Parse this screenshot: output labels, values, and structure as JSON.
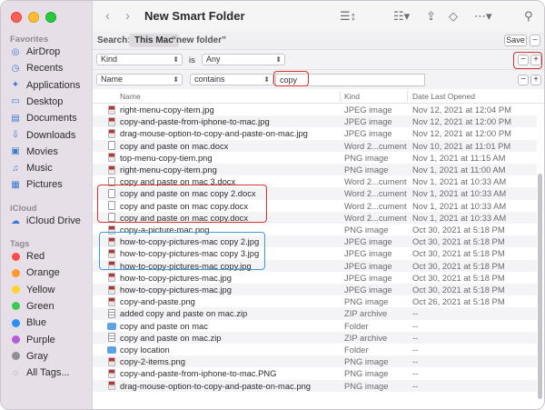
{
  "window": {
    "title": "New Smart Folder"
  },
  "sidebar": {
    "favorites_label": "Favorites",
    "favorites": [
      {
        "label": "AirDrop",
        "icon": "airdrop-icon"
      },
      {
        "label": "Recents",
        "icon": "clock-icon"
      },
      {
        "label": "Applications",
        "icon": "applications-icon"
      },
      {
        "label": "Desktop",
        "icon": "desktop-icon"
      },
      {
        "label": "Documents",
        "icon": "document-icon"
      },
      {
        "label": "Downloads",
        "icon": "download-icon"
      },
      {
        "label": "Movies",
        "icon": "film-icon"
      },
      {
        "label": "Music",
        "icon": "music-note-icon"
      },
      {
        "label": "Pictures",
        "icon": "photo-icon"
      }
    ],
    "icloud_label": "iCloud",
    "icloud": [
      {
        "label": "iCloud Drive",
        "icon": "cloud-icon"
      }
    ],
    "tags_label": "Tags",
    "tags": [
      {
        "label": "Red",
        "color": "#fe4a49"
      },
      {
        "label": "Orange",
        "color": "#fd9a2b"
      },
      {
        "label": "Yellow",
        "color": "#fdd32f"
      },
      {
        "label": "Green",
        "color": "#3fc952"
      },
      {
        "label": "Blue",
        "color": "#2d8ff5"
      },
      {
        "label": "Purple",
        "color": "#b65cd9"
      },
      {
        "label": "Gray",
        "color": "#8e8e93"
      },
      {
        "label": "All Tags...",
        "color": ""
      }
    ]
  },
  "search": {
    "label": "Search:",
    "scope": "This Mac",
    "query": "“new folder”",
    "save_label": "Save"
  },
  "criteria": [
    {
      "attribute": "Kind",
      "operator": "is",
      "value": "Any"
    },
    {
      "attribute": "Name",
      "operator": "contains",
      "value": "copy"
    }
  ],
  "columns": {
    "name": "Name",
    "kind": "Kind",
    "date": "Date Last Opened"
  },
  "files": [
    {
      "name": "right-menu-copy-item.jpg",
      "kind": "JPEG image",
      "date": "Nov 12, 2021 at 12:04 PM",
      "type": "img"
    },
    {
      "name": "copy-and-paste-from-iphone-to-mac.jpg",
      "kind": "JPEG image",
      "date": "Nov 12, 2021 at 12:00 PM",
      "type": "img"
    },
    {
      "name": "drag-mouse-option-to-copy-and-paste-on-mac.jpg",
      "kind": "JPEG image",
      "date": "Nov 12, 2021 at 12:00 PM",
      "type": "img"
    },
    {
      "name": "copy and paste on mac.docx",
      "kind": "Word 2...cument",
      "date": "Nov 10, 2021 at 11:01 PM",
      "type": "word"
    },
    {
      "name": "top-menu-copy-tiem.png",
      "kind": "PNG image",
      "date": "Nov 1, 2021 at 11:15 AM",
      "type": "img"
    },
    {
      "name": "right-menu-copy-item.png",
      "kind": "PNG image",
      "date": "Nov 1, 2021 at 11:00 AM",
      "type": "img"
    },
    {
      "name": "copy and paste on mac 3.docx",
      "kind": "Word 2...cument",
      "date": "Nov 1, 2021 at 10:33 AM",
      "type": "word"
    },
    {
      "name": "copy and paste on mac copy 2.docx",
      "kind": "Word 2...cument",
      "date": "Nov 1, 2021 at 10:33 AM",
      "type": "word"
    },
    {
      "name": "copy and paste on mac copy.docx",
      "kind": "Word 2...cument",
      "date": "Nov 1, 2021 at 10:33 AM",
      "type": "word"
    },
    {
      "name": "copy and paste on mac copy.docx",
      "kind": "Word 2...cument",
      "date": "Nov 1, 2021 at 10:33 AM",
      "type": "word"
    },
    {
      "name": "copy-a-picture-mac.png",
      "kind": "PNG image",
      "date": "Oct 30, 2021 at 5:18 PM",
      "type": "img"
    },
    {
      "name": "how-to-copy-pictures-mac copy 2.jpg",
      "kind": "JPEG image",
      "date": "Oct 30, 2021 at 5:18 PM",
      "type": "img"
    },
    {
      "name": "how-to-copy-pictures-mac copy 3.jpg",
      "kind": "JPEG image",
      "date": "Oct 30, 2021 at 5:18 PM",
      "type": "img"
    },
    {
      "name": "how-to-copy-pictures-mac copy.jpg",
      "kind": "JPEG image",
      "date": "Oct 30, 2021 at 5:18 PM",
      "type": "img"
    },
    {
      "name": "how-to-copy-pictures-mac.jpg",
      "kind": "JPEG image",
      "date": "Oct 30, 2021 at 5:18 PM",
      "type": "img"
    },
    {
      "name": "how-to-copy-pictures-mac.jpg",
      "kind": "JPEG image",
      "date": "Oct 30, 2021 at 5:18 PM",
      "type": "img"
    },
    {
      "name": "copy-and-paste.png",
      "kind": "PNG image",
      "date": "Oct 26, 2021 at 5:18 PM",
      "type": "img"
    },
    {
      "name": "added copy and paste on mac.zip",
      "kind": "ZIP archive",
      "date": "--",
      "type": "zip"
    },
    {
      "name": "copy and paste on mac",
      "kind": "Folder",
      "date": "--",
      "type": "folder"
    },
    {
      "name": "copy and paste on mac.zip",
      "kind": "ZIP archive",
      "date": "--",
      "type": "zip"
    },
    {
      "name": "copy location",
      "kind": "Folder",
      "date": "--",
      "type": "folder"
    },
    {
      "name": "copy-2-items.png",
      "kind": "PNG image",
      "date": "--",
      "type": "img"
    },
    {
      "name": "copy-and-paste-from-iphone-to-mac.PNG",
      "kind": "PNG image",
      "date": "--",
      "type": "img"
    },
    {
      "name": "drag-mouse-option-to-copy-and-paste-on-mac.png",
      "kind": "PNG image",
      "date": "--",
      "type": "img"
    }
  ],
  "highlight_colors": {
    "red": "#d83232",
    "blue": "#3d9ad8"
  }
}
